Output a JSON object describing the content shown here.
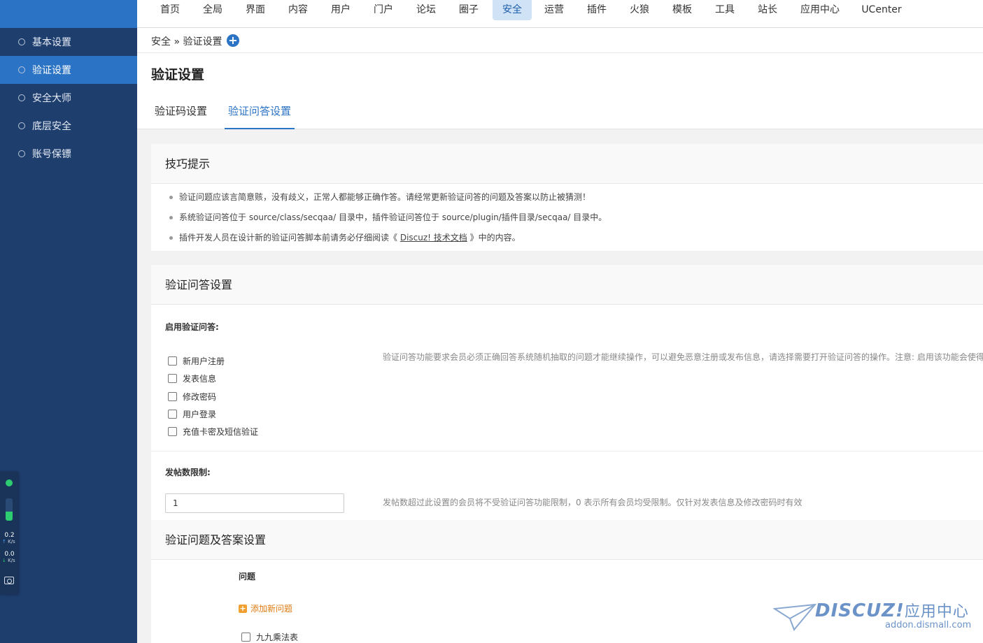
{
  "topnav": {
    "items": [
      "首页",
      "全局",
      "界面",
      "内容",
      "用户",
      "门户",
      "论坛",
      "圈子",
      "安全",
      "运营",
      "插件",
      "火狼",
      "模板",
      "工具",
      "站长",
      "应用中心",
      "UCenter"
    ],
    "active": "安全"
  },
  "sidebar": {
    "items": [
      {
        "label": "基本设置",
        "active": false
      },
      {
        "label": "验证设置",
        "active": true
      },
      {
        "label": "安全大师",
        "active": false
      },
      {
        "label": "底层安全",
        "active": false
      },
      {
        "label": "账号保镖",
        "active": false
      }
    ]
  },
  "net_widget": {
    "upload_value": "0.2",
    "upload_unit": "K/s",
    "download_value": "0.0",
    "download_unit": "K/s",
    "level": 0.4
  },
  "breadcrumb": {
    "text": "安全 » 验证设置",
    "add_icon": "plus-circle-icon"
  },
  "page": {
    "title": "验证设置",
    "tabs": [
      {
        "label": "验证码设置",
        "active": false
      },
      {
        "label": "验证问答设置",
        "active": true
      }
    ]
  },
  "tips": {
    "heading": "技巧提示",
    "items": [
      "验证问题应该言简意赅，没有歧义，正常人都能够正确作答。请经常更新验证问答的问题及答案以防止被猜测！",
      "系统验证问答位于 source/class/secqaa/ 目录中，插件验证问答位于 source/plugin/插件目录/secqaa/ 目录中。"
    ],
    "item3_prefix": "插件开发人员在设计新的验证问答脚本前请务必仔细阅读《 ",
    "item3_link": "Discuz! 技术文档",
    "item3_suffix": " 》中的内容。"
  },
  "qa_settings": {
    "heading": "验证问答设置",
    "enable_label": "启用验证问答:",
    "options": [
      "新用户注册",
      "发表信息",
      "修改密码",
      "用户登录",
      "充值卡密及短信验证"
    ],
    "enable_hint": "验证问答功能要求会员必须正确回答系统随机抽取的问题才能继续操作，可以避免恶意注册或发布信息，请选择需要打开验证问答的操作。注意: 启用该功能会使得",
    "post_limit_label": "发帖数限制:",
    "post_limit_value": "1",
    "post_limit_hint": "发帖数超过此设置的会员将不受验证问答功能限制，0 表示所有会员均受限制。仅针对发表信息及修改密码时有效"
  },
  "qa_list": {
    "heading": "验证问题及答案设置",
    "column_question": "问题",
    "add_label": "添加新问题",
    "rows": [
      "九九乘法表"
    ]
  },
  "watermark": {
    "brand": "DISCUZ!",
    "brand_suffix": "应用中心",
    "url": "addon.dismall.com"
  },
  "colors": {
    "sidebar_bg": "#1e3e6e",
    "accent": "#2b73c4",
    "add_link": "#e07a10"
  }
}
